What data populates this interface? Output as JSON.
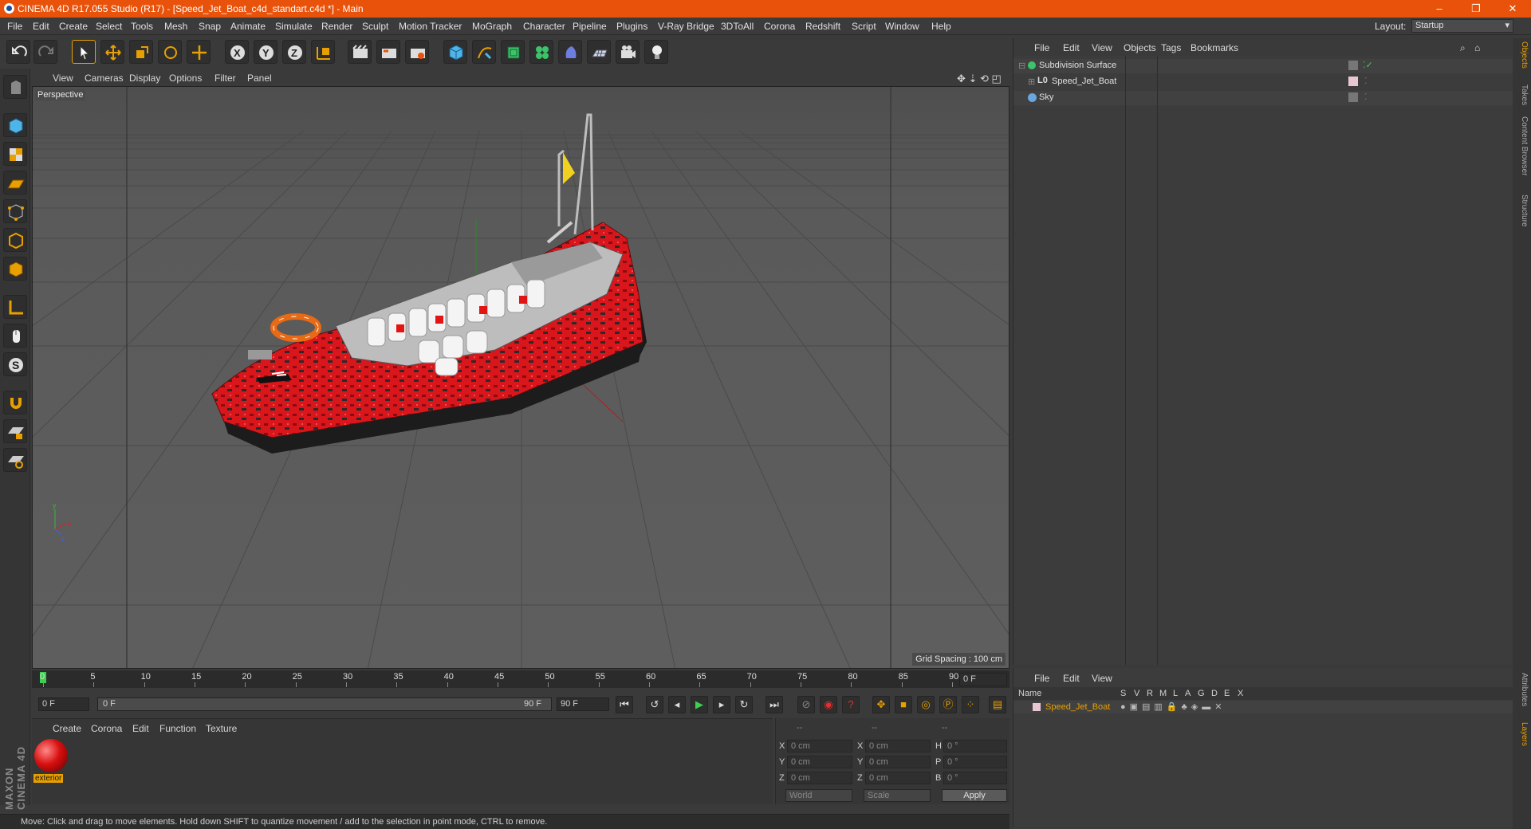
{
  "window": {
    "title": "CINEMA 4D R17.055 Studio (R17) - [Speed_Jet_Boat_c4d_standart.c4d *] - Main",
    "controls": [
      "–",
      "❐",
      "✕"
    ]
  },
  "menu": {
    "items": [
      "File",
      "Edit",
      "Create",
      "Select",
      "Tools",
      "Mesh",
      "Snap",
      "Animate",
      "Simulate",
      "Render",
      "Sculpt",
      "Motion Tracker",
      "MoGraph",
      "Character",
      "Pipeline",
      "Plugins",
      "V-Ray Bridge",
      "3DToAll",
      "Corona",
      "Redshift",
      "Script",
      "Window",
      "Help"
    ],
    "layout_label": "Layout:",
    "layout_value": "Startup"
  },
  "viewport": {
    "menu": [
      "View",
      "Cameras",
      "Display",
      "Options",
      "Filter",
      "Panel"
    ],
    "camera_label": "Perspective",
    "grid_spacing": "Grid Spacing : 100 cm"
  },
  "timeline": {
    "ticks": [
      "0",
      "5",
      "10",
      "15",
      "20",
      "25",
      "30",
      "35",
      "40",
      "45",
      "50",
      "55",
      "60",
      "65",
      "70",
      "75",
      "80",
      "85",
      "90"
    ],
    "current_frame": "0 F",
    "start_field": "0 F",
    "range_start": "0 F",
    "range_end": "90 F",
    "end_field": "90 F"
  },
  "material_panel": {
    "menu": [
      "Create",
      "Corona",
      "Edit",
      "Function",
      "Texture"
    ],
    "material_name": "exterior"
  },
  "coordinates": {
    "header": [
      "--",
      "--",
      "--"
    ],
    "rows": [
      {
        "a": "X",
        "av": "0 cm",
        "b": "X",
        "bv": "0 cm",
        "c": "H",
        "cv": "0 °"
      },
      {
        "a": "Y",
        "av": "0 cm",
        "b": "Y",
        "bv": "0 cm",
        "c": "P",
        "cv": "0 °"
      },
      {
        "a": "Z",
        "av": "0 cm",
        "b": "Z",
        "bv": "0 cm",
        "c": "B",
        "cv": "0 °"
      }
    ],
    "world": "World",
    "scale": "Scale",
    "apply": "Apply"
  },
  "object_manager": {
    "menu": [
      "File",
      "Edit",
      "View",
      "Objects",
      "Tags",
      "Bookmarks"
    ],
    "objects": [
      {
        "name": "Subdivision Surface",
        "indent": 0
      },
      {
        "name": "Speed_Jet_Boat",
        "indent": 1
      },
      {
        "name": "Sky",
        "indent": 0
      }
    ]
  },
  "attribute_manager": {
    "menu": [
      "File",
      "Edit",
      "View"
    ],
    "columns": [
      "Name",
      "S",
      "V",
      "R",
      "M",
      "L",
      "A",
      "G",
      "D",
      "E",
      "X"
    ],
    "layer_name": "Speed_Jet_Boat"
  },
  "right_tabs": [
    "Objects",
    "Takes",
    "Content Browser",
    "Structure",
    "Attributes",
    "Layers"
  ],
  "status": "Move: Click and drag to move elements. Hold down SHIFT to quantize movement / add to the selection in point mode, CTRL to remove.",
  "brand": "MAXON CINEMA 4D",
  "colors": {
    "titlebar": "#e8520a",
    "accent": "#e8a000",
    "boat": "#d91a1a"
  }
}
